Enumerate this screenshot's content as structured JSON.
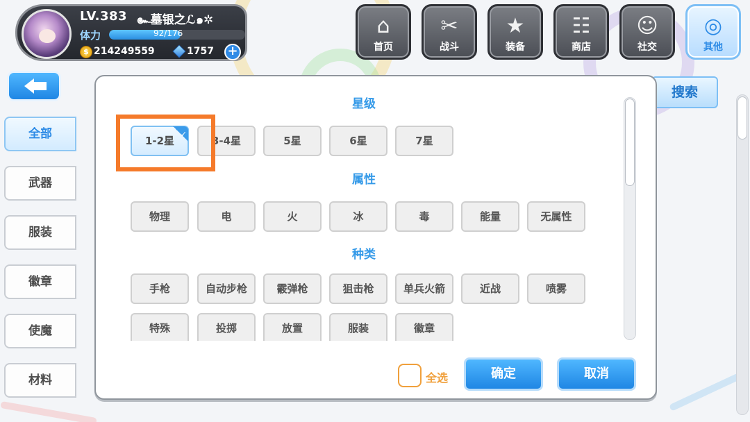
{
  "player": {
    "level": "LV.383",
    "name": "๛墓银之ℒ๑✲",
    "stamina_label": "体力",
    "stamina_text": "92/176",
    "stamina_fraction": 0.523,
    "gold": "214249559",
    "gems": "1757",
    "add_symbol": "+"
  },
  "nav": [
    {
      "label": "首页",
      "icon": "home-icon",
      "glyph": "⌂"
    },
    {
      "label": "战斗",
      "icon": "crossed-guns-icon",
      "glyph": "✂"
    },
    {
      "label": "装备",
      "icon": "star-gun-icon",
      "glyph": "★"
    },
    {
      "label": "商店",
      "icon": "shopping-basket-icon",
      "glyph": "☷"
    },
    {
      "label": "社交",
      "icon": "character-face-icon",
      "glyph": "☺"
    },
    {
      "label": "其他",
      "icon": "snail-target-icon",
      "glyph": "◎"
    }
  ],
  "side_tabs": [
    "全部",
    "武器",
    "服装",
    "徽章",
    "使魔",
    "材料"
  ],
  "search_label": "搜索",
  "sections": {
    "star": {
      "title": "星级",
      "options": [
        "1-2星",
        "3-4星",
        "5星",
        "6星",
        "7星"
      ],
      "selected": "1-2星"
    },
    "attribute": {
      "title": "属性",
      "options": [
        "物理",
        "电",
        "火",
        "冰",
        "毒",
        "能量",
        "无属性"
      ]
    },
    "type": {
      "title": "种类",
      "options": [
        "手枪",
        "自动步枪",
        "霰弹枪",
        "狙击枪",
        "单兵火箭",
        "近战",
        "喷雾",
        "特殊",
        "投掷",
        "放置",
        "服装",
        "徽章"
      ]
    }
  },
  "select_all_label": "全选",
  "confirm_label": "确定",
  "cancel_label": "取消",
  "colors": {
    "accent_blue": "#2d8be6",
    "highlight_orange": "#f57a2a",
    "select_all_orange": "#f0a03c"
  }
}
